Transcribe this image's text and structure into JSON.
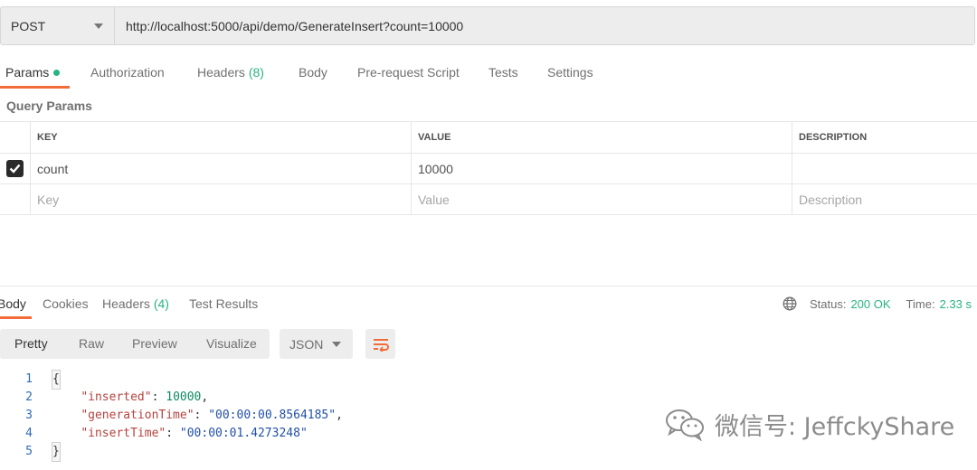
{
  "request": {
    "method": "POST",
    "url": "http://localhost:5000/api/demo/GenerateInsert?count=10000"
  },
  "request_tabs": {
    "params": "Params",
    "authorization": "Authorization",
    "headers": "Headers",
    "headers_count": "(8)",
    "body": "Body",
    "prerequest": "Pre-request Script",
    "tests": "Tests",
    "settings": "Settings"
  },
  "query_params": {
    "title": "Query Params",
    "columns": {
      "key": "KEY",
      "value": "VALUE",
      "description": "DESCRIPTION"
    },
    "rows": [
      {
        "checked": true,
        "key": "count",
        "value": "10000",
        "description": ""
      }
    ],
    "placeholders": {
      "key": "Key",
      "value": "Value",
      "description": "Description"
    }
  },
  "response_tabs": {
    "body": "Body",
    "cookies": "Cookies",
    "headers": "Headers",
    "headers_count": "(4)",
    "test_results": "Test Results"
  },
  "response_status": {
    "status_label": "Status:",
    "status_value": "200 OK",
    "time_label": "Time:",
    "time_value": "2.33 s"
  },
  "view_modes": {
    "pretty": "Pretty",
    "raw": "Raw",
    "preview": "Preview",
    "visualize": "Visualize",
    "format": "JSON"
  },
  "code": {
    "line_numbers": [
      "1",
      "2",
      "3",
      "4",
      "5"
    ],
    "open_brace": "{",
    "close_brace": "}",
    "fields": [
      {
        "key": "\"inserted\"",
        "value": "10000",
        "trail": ","
      },
      {
        "key": "\"generationTime\"",
        "value": "\"00:00:00.8564185\"",
        "trail": ","
      },
      {
        "key": "\"insertTime\"",
        "value": "\"00:00:01.4273248\"",
        "trail": ""
      }
    ]
  },
  "watermark": "微信号: JeffckyShare",
  "colors": {
    "accent": "#f26b3a",
    "success": "#26b47f",
    "json_key": "#b5423e",
    "json_string": "#2250a8",
    "line_number": "#2e6bb5"
  }
}
